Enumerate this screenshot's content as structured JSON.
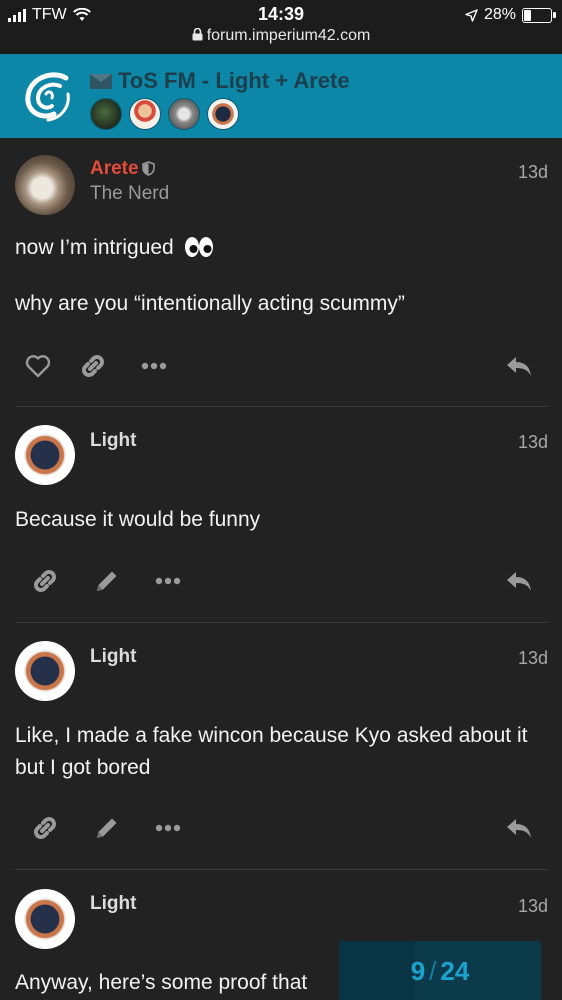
{
  "status_bar": {
    "carrier": "TFW",
    "time": "14:39",
    "url": "forum.imperium42.com",
    "battery": "28%"
  },
  "topic": {
    "title": "ToS FM - Light + Arete",
    "participant_count": 4
  },
  "posts": [
    {
      "username": "Arete",
      "user_title": "The Nerd",
      "date": "13d",
      "paragraphs": [
        "now I’m intrigued",
        "why are you “intentionally acting scummy”"
      ],
      "emoji": "eyes-icon"
    },
    {
      "username": "Light",
      "date": "13d",
      "paragraphs": [
        "Because it would be funny"
      ]
    },
    {
      "username": "Light",
      "date": "13d",
      "paragraphs": [
        "Like, I made a fake wincon because Kyo asked about it but I got bored"
      ]
    },
    {
      "username": "Light",
      "date": "13d",
      "paragraphs": [
        "Anyway, here’s some proof that"
      ]
    }
  ],
  "progress": {
    "current": "9",
    "total": "24",
    "fraction": 0.375
  },
  "colors": {
    "background": "#222222",
    "header": "#0d87a8",
    "username_highlight": "#e24c3a",
    "progress_text": "#1ba3cf"
  }
}
